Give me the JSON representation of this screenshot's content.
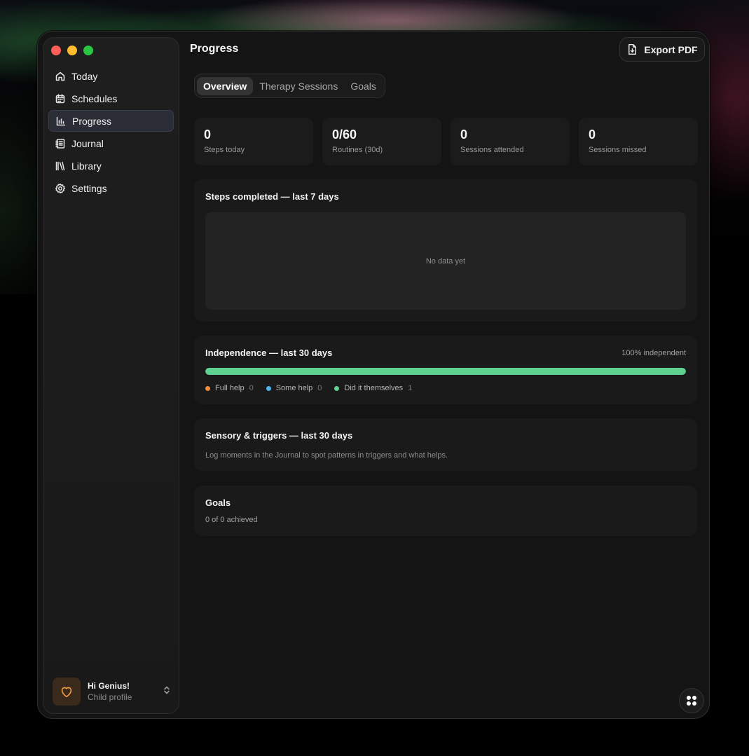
{
  "nav": {
    "items": [
      {
        "label": "Today",
        "icon": "home-icon"
      },
      {
        "label": "Schedules",
        "icon": "calendar-icon"
      },
      {
        "label": "Progress",
        "icon": "bar-chart-icon"
      },
      {
        "label": "Journal",
        "icon": "notebook-icon"
      },
      {
        "label": "Library",
        "icon": "library-icon"
      },
      {
        "label": "Settings",
        "icon": "gear-icon"
      }
    ],
    "active": "Progress"
  },
  "profile": {
    "name": "Hi Genius!",
    "subtitle": "Child profile",
    "icon": "heart-icon"
  },
  "header": {
    "title": "Progress",
    "export_label": "Export PDF"
  },
  "tabs": [
    {
      "label": "Overview"
    },
    {
      "label": "Therapy Sessions"
    },
    {
      "label": "Goals"
    }
  ],
  "stats": [
    {
      "value": "0",
      "label": "Steps today"
    },
    {
      "value": "0/60",
      "label": "Routines (30d)"
    },
    {
      "value": "0",
      "label": "Sessions attended"
    },
    {
      "value": "0",
      "label": "Sessions missed"
    }
  ],
  "steps_chart": {
    "title": "Steps completed — last 7 days",
    "empty_text": "No data yet"
  },
  "independence": {
    "title": "Independence — last 30 days",
    "percent_label": "100% independent",
    "independent_fraction": 1.0,
    "legend": [
      {
        "label": "Full help",
        "count": "0",
        "color": "#f08a3c"
      },
      {
        "label": "Some help",
        "count": "0",
        "color": "#4fb3f0"
      },
      {
        "label": "Did it themselves",
        "count": "1",
        "color": "#5fd190"
      }
    ]
  },
  "sensory": {
    "title": "Sensory & triggers — last 30 days",
    "description": "Log moments in the Journal to spot patterns in triggers and what helps."
  },
  "goals": {
    "title": "Goals",
    "summary": "0 of 0 achieved"
  },
  "colors": {
    "accent_green": "#5fd190",
    "profile_orange": "#f19a3e"
  }
}
